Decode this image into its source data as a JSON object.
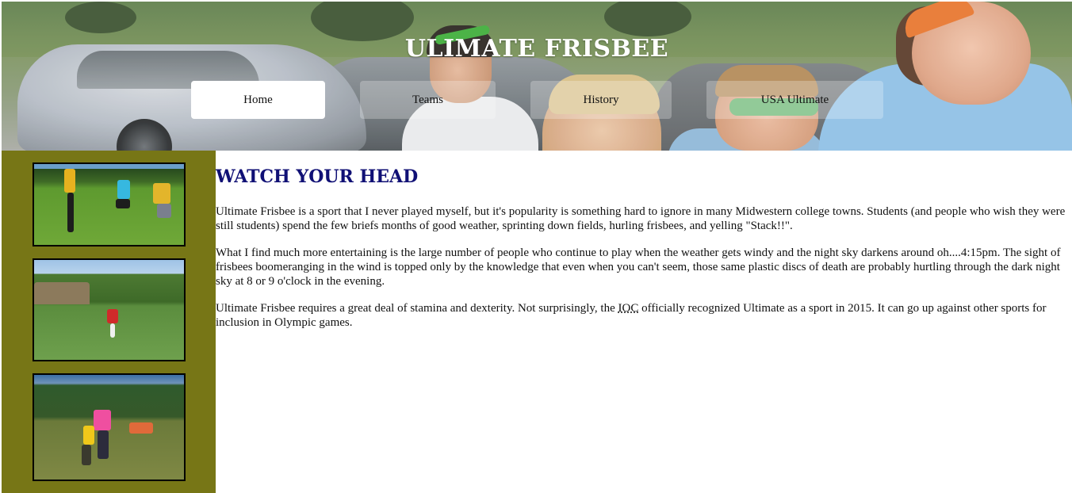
{
  "header": {
    "title": "ULIMATE FRISBEE",
    "banner_photo": "ultimate-players-running-photo"
  },
  "nav": {
    "items": [
      {
        "label": "Home",
        "active": true
      },
      {
        "label": "Teams",
        "active": false
      },
      {
        "label": "History",
        "active": false
      },
      {
        "label": "USA Ultimate",
        "active": false
      }
    ]
  },
  "sidebar": {
    "background": "#777616",
    "photos": [
      "frisbee-game-photo-1",
      "frisbee-game-photo-2",
      "frisbee-game-photo-3"
    ]
  },
  "article": {
    "heading": "WATCH YOUR HEAD",
    "heading_color": "#101075",
    "paragraphs": [
      "Ultimate Frisbee is a sport that I never played myself, but it's popularity is something hard to ignore in many Midwestern college towns. Students (and people who wish they were still students) spend the few briefs months of good weather, sprinting down fields, hurling frisbees, and yelling \"Stack!!\".",
      "What I find much more entertaining is the large number of people who continue to play when the weather gets windy and the night sky darkens around oh....4:15pm. The sight of frisbees boomeranging in the wind is topped only by the knowledge that even when you can't seem, those same plastic discs of death are probably hurtling through the dark night sky at 8 or 9 o'clock in the evening."
    ],
    "para3": {
      "before": "Ultimate Frisbee requires a great deal of stamina and dexterity. Not surprisingly, the ",
      "abbr": "IOC",
      "after": " officially recognized Ultimate as a sport in 2015. It can go up against other sports for inclusion in Olympic games."
    }
  }
}
